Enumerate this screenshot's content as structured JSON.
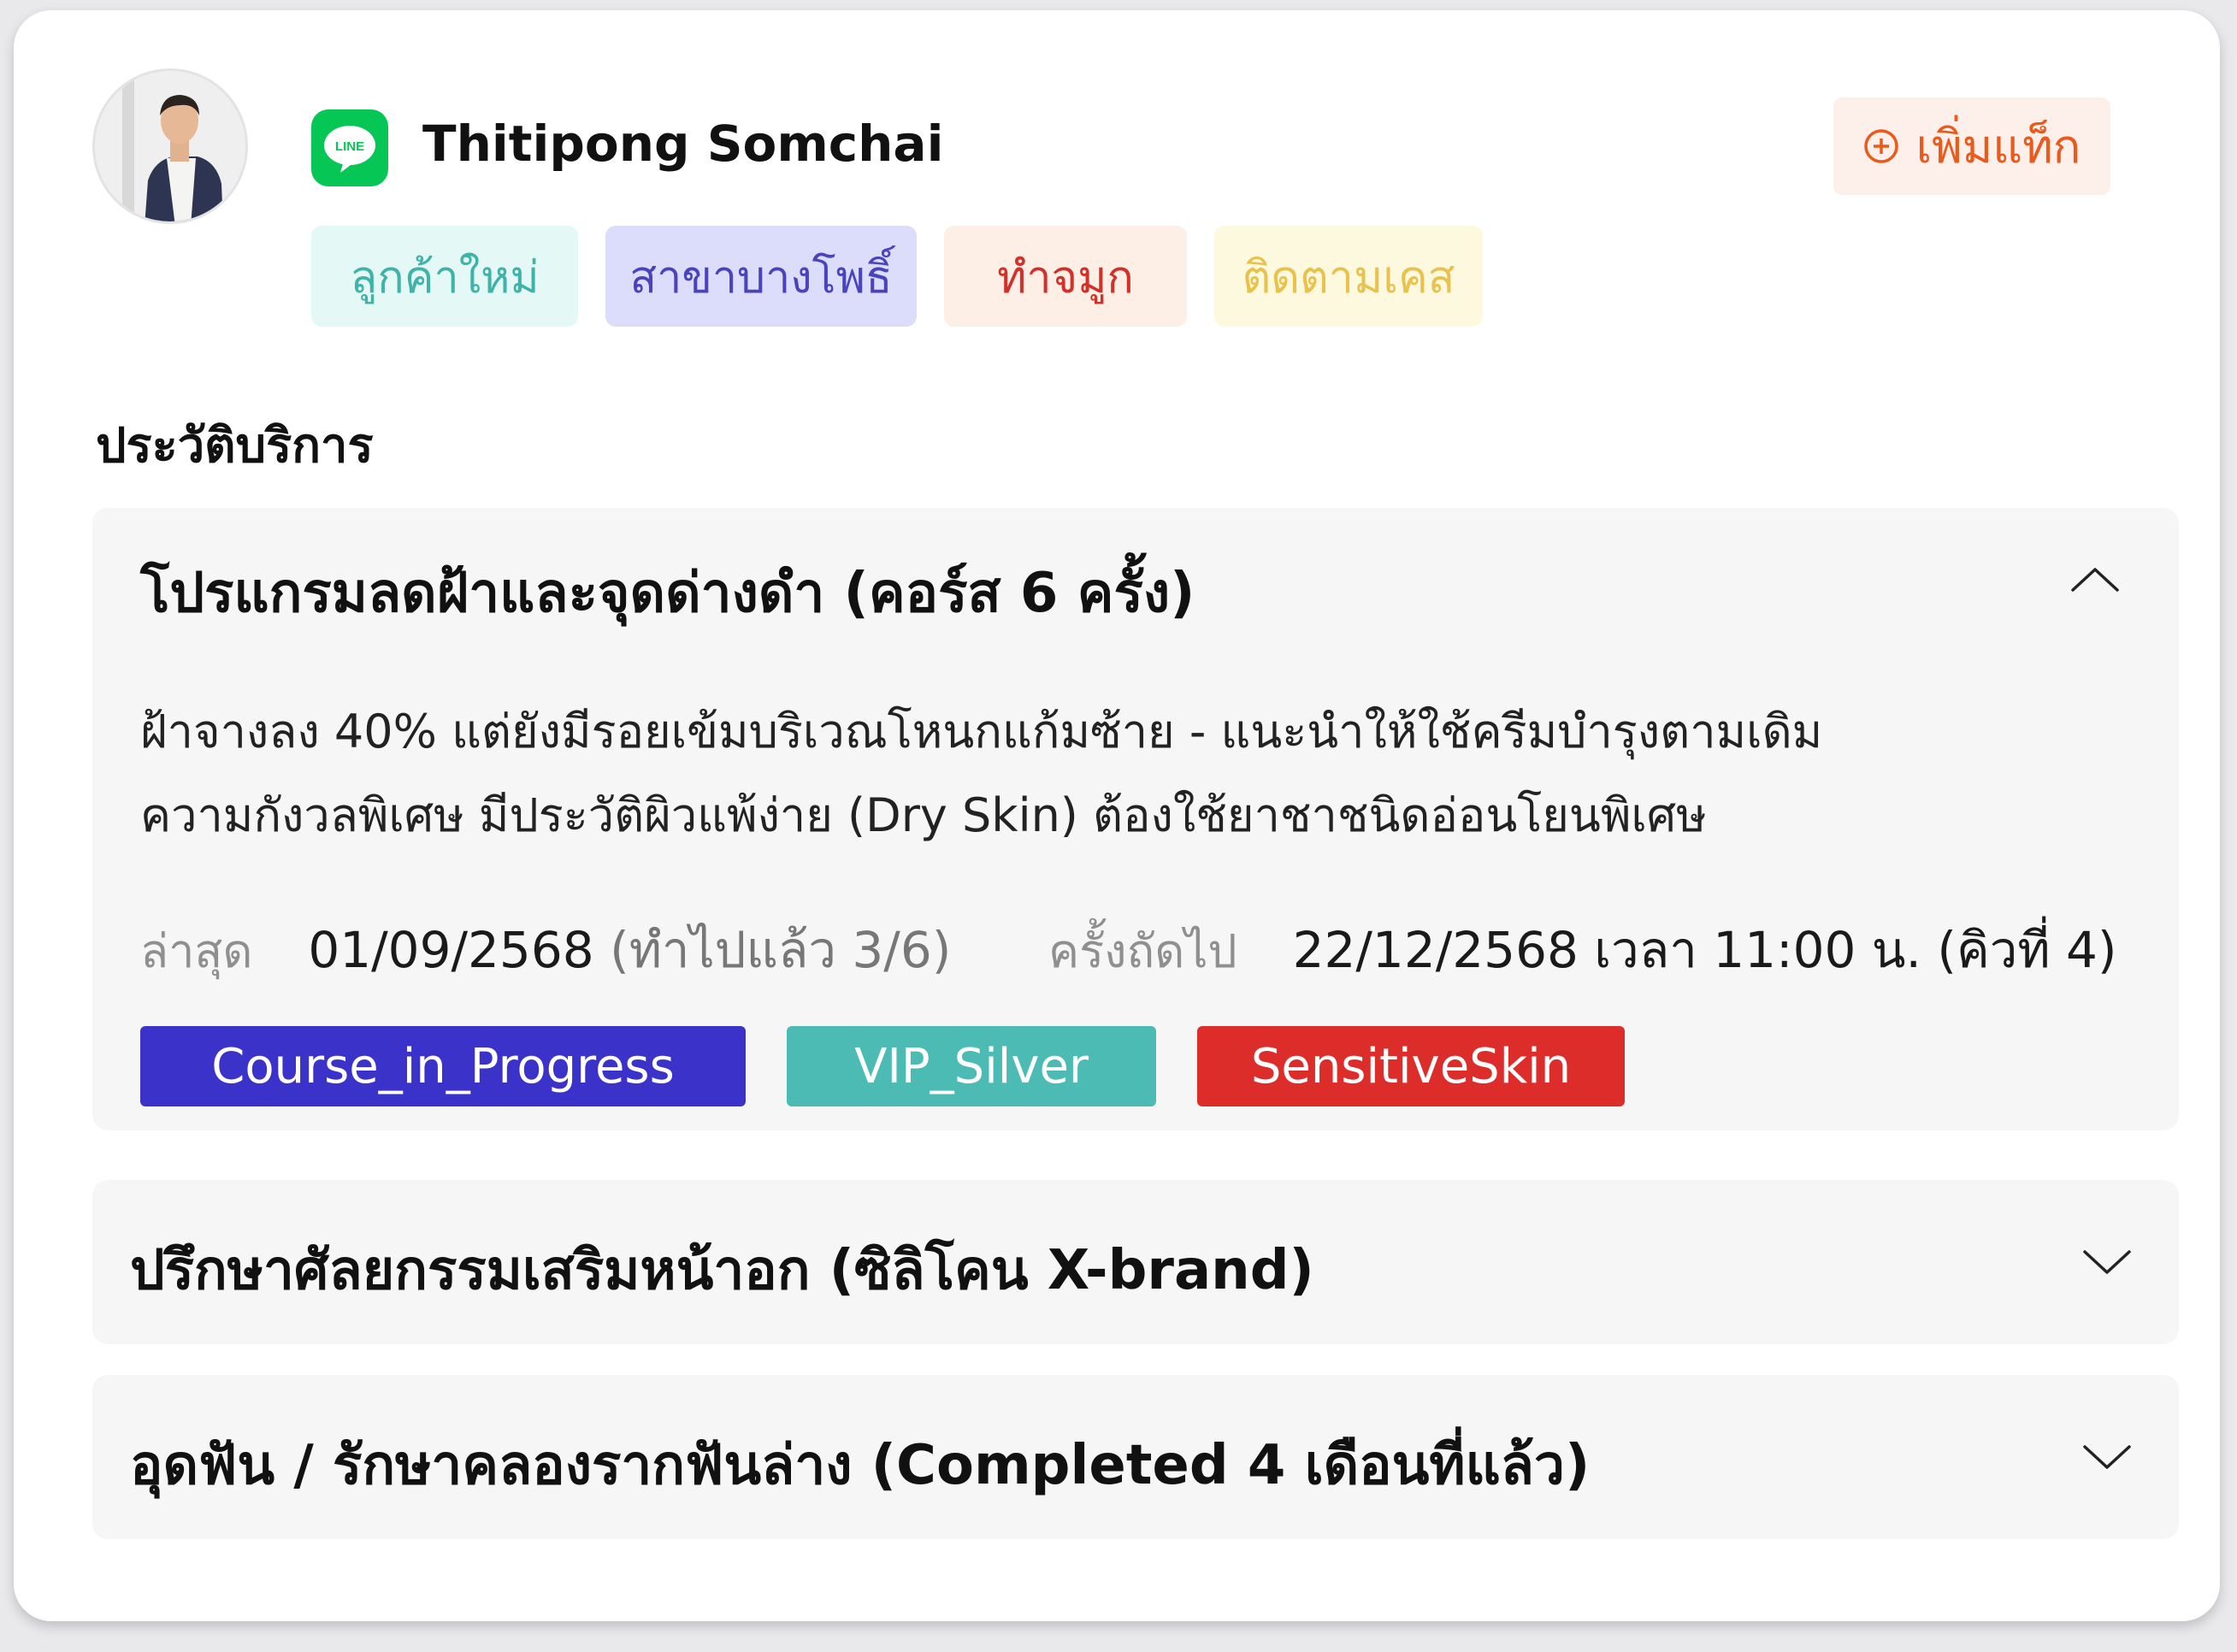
{
  "profile": {
    "name": "Thitipong Somchai",
    "channel_icon": "line-icon",
    "channel_label": "LINE",
    "add_tag_label": "เพิ่มแท็ก",
    "tags": [
      "ลูกค้าใหม่",
      "สาขาบางโพธิ์",
      "ทำจมูก",
      "ติดตามเคส"
    ]
  },
  "history": {
    "title": "ประวัติบริการ",
    "items": [
      {
        "title": "โปรแกรมลดฝ้าและจุดด่างดำ (คอร์ส 6 ครั้ง)",
        "expanded": true,
        "notes": [
          "ฝ้าจางลง 40% แต่ยังมีรอยเข้มบริเวณโหนกแก้มซ้าย - แนะนำให้ใช้ครีมบำรุงตามเดิม",
          "ความกังวลพิเศษ มีประวัติผิวแพ้ง่าย (Dry Skin) ต้องใช้ยาชาชนิดอ่อนโยนพิเศษ"
        ],
        "last_label": "ล่าสุด",
        "last_date": "01/09/2568",
        "last_progress": "(ทำไปแล้ว 3/6)",
        "next_label": "ครั้งถัดไป",
        "next_value": "22/12/2568 เวลา 11:00 น. (คิวที่ 4)",
        "labels": [
          "Course_in_Progress",
          "VIP_Silver",
          "SensitiveSkin"
        ]
      },
      {
        "title": "ปรึกษาศัลยกรรมเสริมหน้าอก (ซิลิโคน X-brand)",
        "expanded": false
      },
      {
        "title": "อุดฟัน / รักษาคลองรากฟันล่าง (Completed 4 เดือนที่แล้ว)",
        "expanded": false
      }
    ]
  },
  "colors": {
    "accent_orange": "#ea5a1c",
    "line_green": "#06c755",
    "label_blue": "#3b32c9",
    "label_teal": "#4bbbb4",
    "label_red": "#dc2d2b"
  }
}
